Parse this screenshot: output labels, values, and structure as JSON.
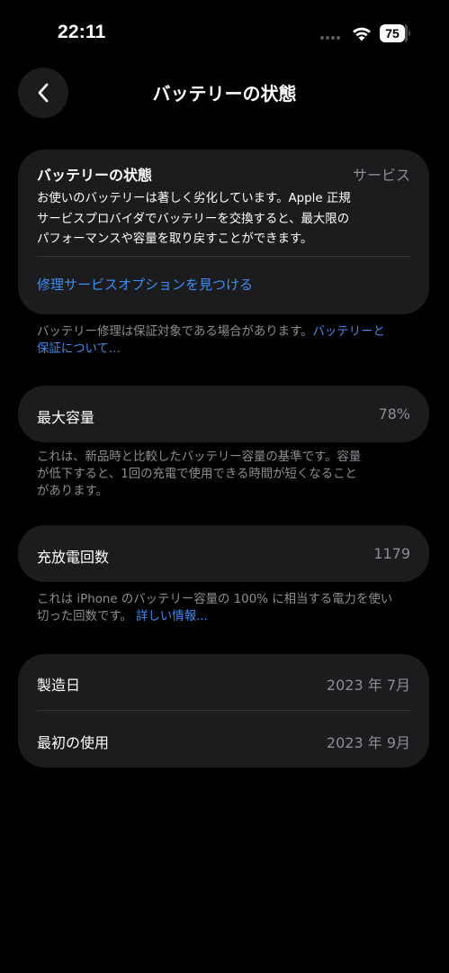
{
  "status": {
    "time": "22:11",
    "battery_level": "75"
  },
  "nav": {
    "title": "バッテリーの状態"
  },
  "service_card": {
    "title": "バッテリーの状態",
    "tag": "サービス",
    "body_lines": [
      "お使いのバッテリーは著しく劣化しています。Apple 正規",
      "サービスプロバイダでバッテリーを交換すると、最大限の",
      "パフォーマンスや容量を取り戻すことができます。"
    ],
    "link": "修理サービスオプションを見つける"
  },
  "service_footnote": {
    "line1_text": "バッテリー修理は保証対象である場合があります。",
    "line1_link": "バッテリーと",
    "line2_link": "保証について..."
  },
  "capacity": {
    "label": "最大容量",
    "value": "78%",
    "footnote_lines": [
      "これは、新品時と比較したバッテリー容量の基準です。容量",
      "が低下すると、1回の充電で使用できる時間が短くなること",
      "があります。"
    ]
  },
  "cycles": {
    "label": "充放電回数",
    "value": "1179",
    "footnote_line1": "これは iPhone のバッテリー容量の 100% に相当する電力を使い",
    "footnote_line2_text": "切った回数です。",
    "footnote_link": "詳しい情報..."
  },
  "dates": {
    "manufacture_label": "製造日",
    "manufacture_value": "2023 年 7月",
    "first_use_label": "最初の使用",
    "first_use_value": "2023 年 9月"
  },
  "colors": {
    "background": "#000000",
    "card": "#1c1c1e",
    "secondary_text": "#8e8e93",
    "link": "#3b8ef0"
  },
  "icons": [
    "back-chevron-icon",
    "wifi-icon",
    "battery-icon",
    "cellular-signal-icon"
  ]
}
